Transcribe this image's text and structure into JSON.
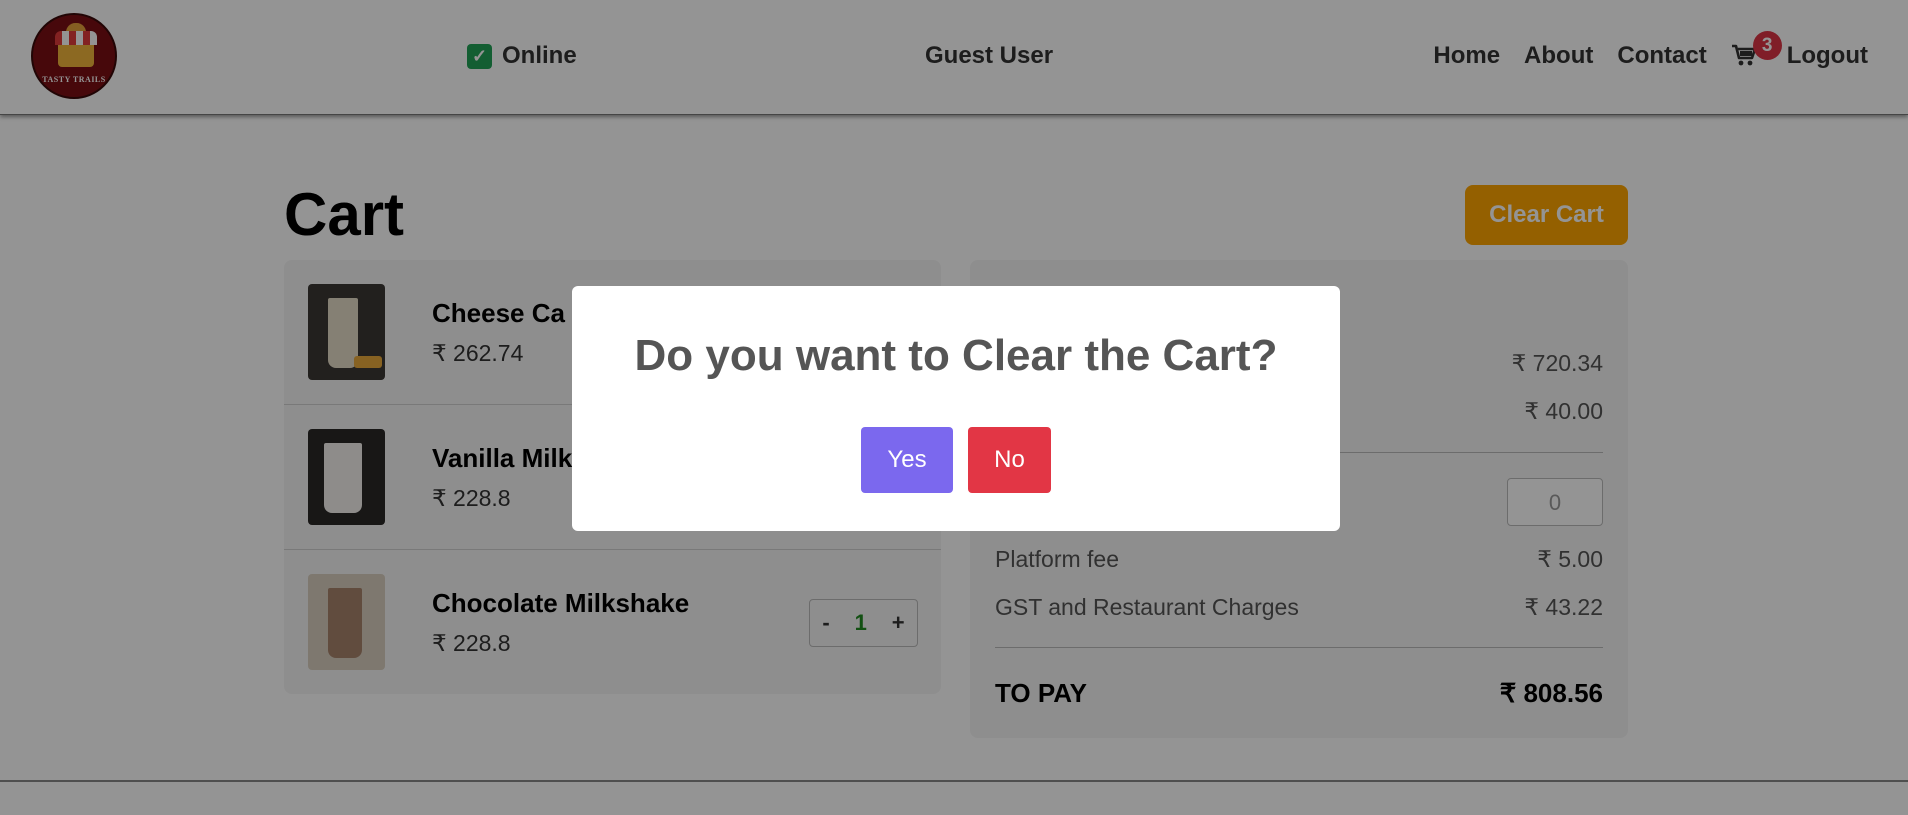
{
  "header": {
    "logo_text": "TASTY TRAILS",
    "status": "Online",
    "user": "Guest User",
    "nav": {
      "home": "Home",
      "about": "About",
      "contact": "Contact",
      "logout": "Logout"
    },
    "cart_count": "3"
  },
  "page": {
    "title": "Cart",
    "clear_label": "Clear Cart"
  },
  "items": [
    {
      "name": "Cheese Ca",
      "price": "₹ 262.74"
    },
    {
      "name": "Vanilla Milk",
      "price": "₹ 228.8"
    },
    {
      "name": "Chocolate Milkshake",
      "price": "₹ 228.8",
      "qty": "1",
      "minus": "-",
      "plus": "+"
    }
  ],
  "summary": {
    "item_total": "₹ 720.34",
    "delivery": "₹ 40.00",
    "tip_placeholder": "0",
    "platform_label": "Platform fee",
    "platform_value": "₹ 5.00",
    "gst_label": "GST and Restaurant Charges",
    "gst_value": "₹ 43.22",
    "to_pay_label": "TO PAY",
    "to_pay_value": "₹ 808.56"
  },
  "modal": {
    "title": "Do you want to Clear the Cart?",
    "yes": "Yes",
    "no": "No"
  },
  "colors": {
    "accent_orange": "#ffa500",
    "yes_button": "#7b68ee",
    "no_button": "#e23645",
    "online_green": "#22a356",
    "badge_red": "#dc3545"
  }
}
